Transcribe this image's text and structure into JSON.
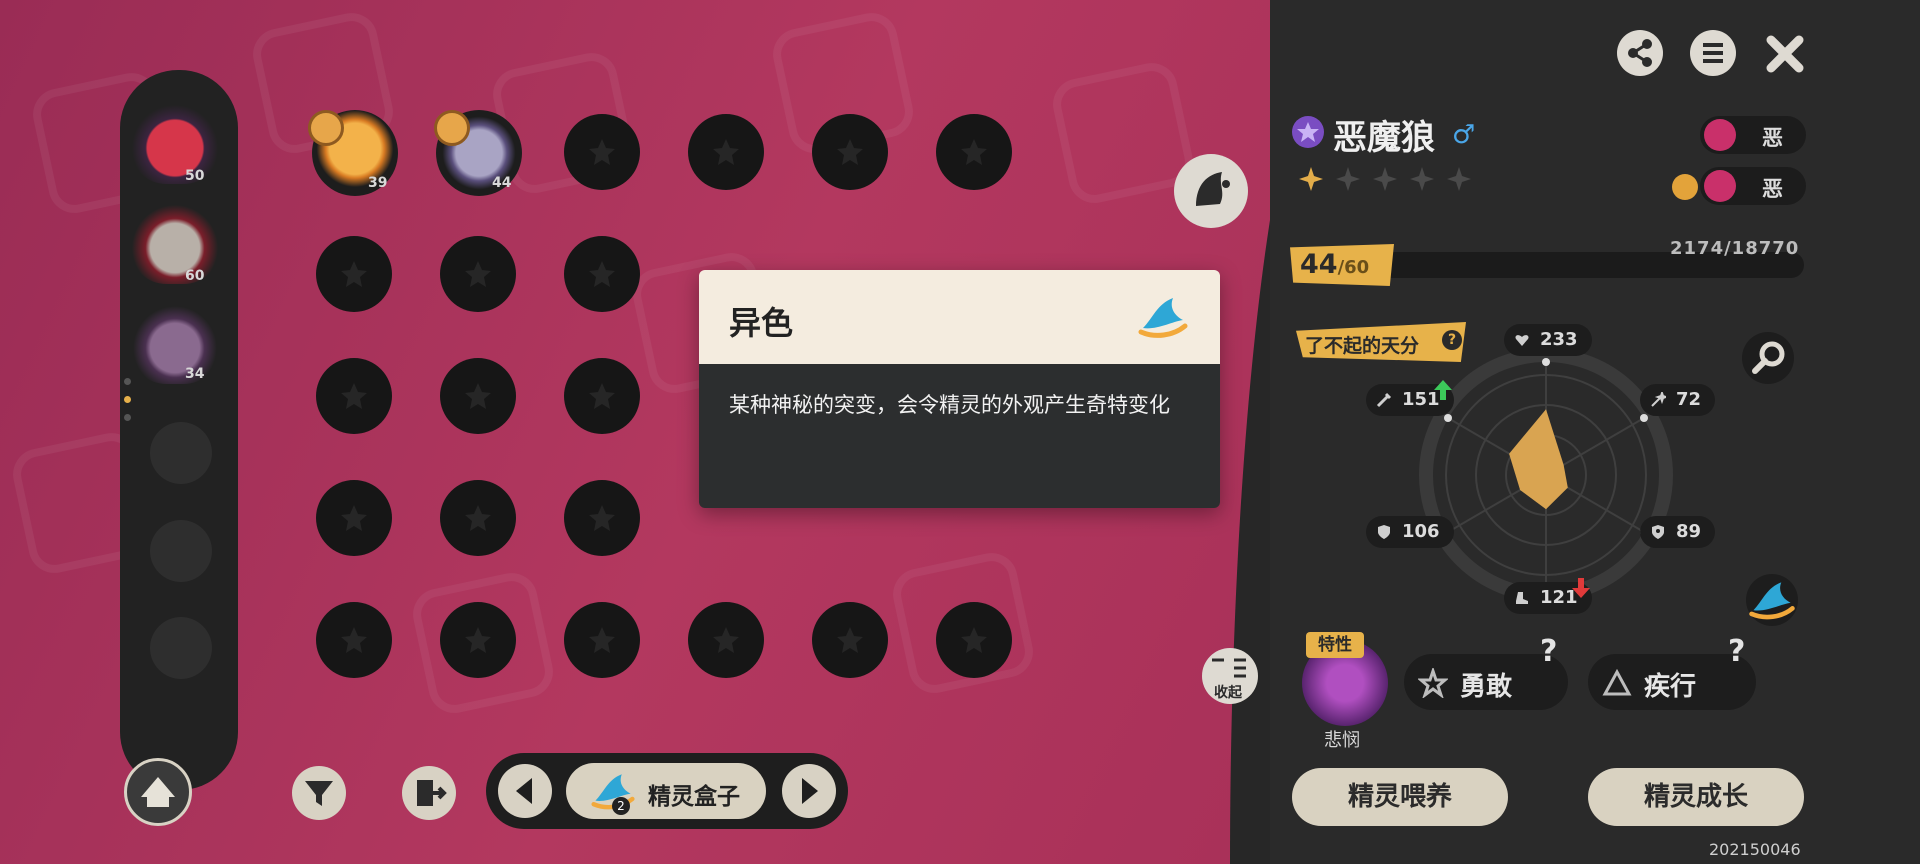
{
  "roster": {
    "pets": [
      {
        "level": "50",
        "color": "#d6364a"
      },
      {
        "level": "60",
        "color": "#b8b0a8"
      },
      {
        "level": "34",
        "color": "#8a6a8f"
      }
    ]
  },
  "grid": {
    "pets": [
      {
        "level": "39",
        "color": "#f0a030"
      },
      {
        "level": "44",
        "color": "#a9a4c4"
      }
    ]
  },
  "popup": {
    "title": "异色",
    "description": "某种神秘的突变，会令精灵的外观产生奇特变化"
  },
  "bottom": {
    "box_label": "精灵盒子",
    "box_count": "2"
  },
  "pet": {
    "name": "恶魔狼",
    "gender": "♂",
    "types": [
      "恶",
      "恶"
    ],
    "level": "44",
    "level_max": "/60",
    "exp": "2174/18770",
    "talent_label": "了不起的天分",
    "stats": {
      "hp": "233",
      "atk": "151",
      "sp_atk": "72",
      "def": "106",
      "sp_def": "89",
      "speed": "121"
    },
    "trait_tag": "特性",
    "ability_name": "悲悯",
    "traits": [
      "勇敢",
      "疾行"
    ],
    "collapse_label": "收起"
  },
  "buttons": {
    "feed": "精灵喂养",
    "grow": "精灵成长"
  },
  "uid": "202150046",
  "colors": {
    "accent": "#e7b24a",
    "radar_fill": "#d9a451",
    "up_arrow": "#3cc95a",
    "down_arrow": "#e03a3a"
  }
}
